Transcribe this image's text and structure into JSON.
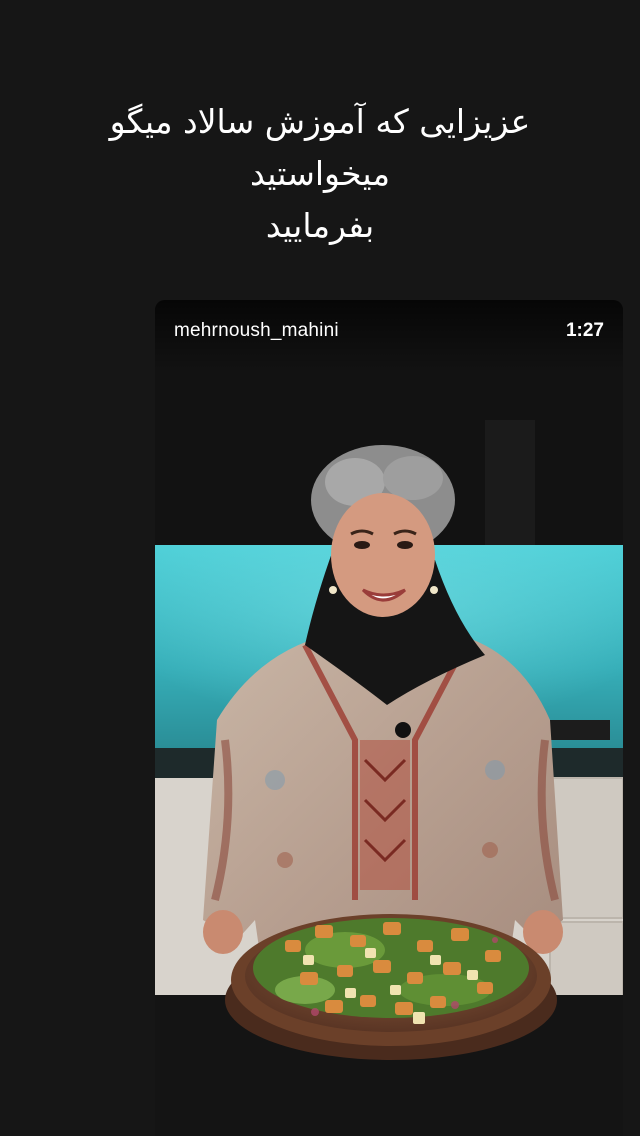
{
  "caption": {
    "line1": "عزیزایی که آموزش سالاد میگو",
    "line2": "میخواستید",
    "line3": "بفرمایید"
  },
  "video": {
    "username": "mehrnoush_mahini",
    "duration": "1:27"
  },
  "colors": {
    "background": "#161616",
    "backsplash": "#3fc1c9",
    "text": "#ffffff"
  }
}
